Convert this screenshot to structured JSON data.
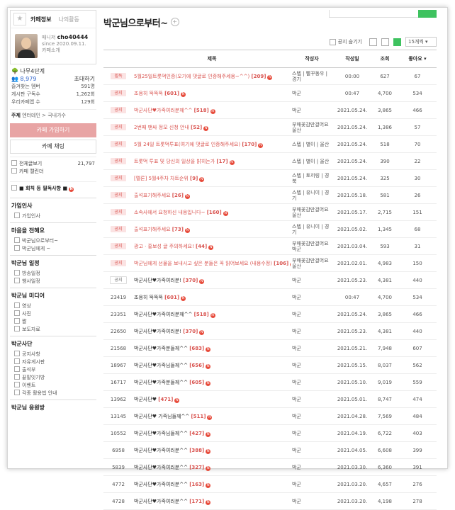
{
  "sidebar": {
    "tabs": [
      "카페정보",
      "나의활동"
    ],
    "profile": {
      "role": "매니저",
      "id": "cho40444",
      "since": "since 2020.09.11.",
      "intro": "카페소개"
    },
    "stats": {
      "level": "나무4단계",
      "members": "8,979",
      "invite": "초대하기",
      "fav_label": "즐겨찾는 멤버",
      "fav_value": "591명",
      "sub_label": "게시판 구독수",
      "sub_value": "1,262회",
      "rank_label": "우리카페앱 수",
      "rank_value": "129회"
    },
    "topic": {
      "label": "주제",
      "value": "엔터테인 > 국내가수"
    },
    "join_button": "카페 가입하기",
    "chat_button": "카페 채팅",
    "total": {
      "label": "전체글보기",
      "value": "21,797"
    },
    "calendar": "카페 캘린더",
    "pinned": "회칙 등 필독사항",
    "sections": [
      {
        "title": "가입인사",
        "items": [
          "가입인사"
        ]
      },
      {
        "title": "마음을 전해요",
        "items": [
          "박군님으로부터~",
          "박군님에게 ~"
        ]
      },
      {
        "title": "박군님 일정",
        "items": [
          "방송일정",
          "행사일정"
        ]
      },
      {
        "title": "박군님 미디어",
        "items": [
          "영상",
          "사진",
          "짤",
          "보도자료"
        ]
      },
      {
        "title": "박군사단",
        "items": [
          "공지사항",
          "자유게시판",
          "출석부",
          "끝말잇기방",
          "이벤트",
          "각종 활용법 안내"
        ]
      },
      {
        "title": "박군님 응원방",
        "items": []
      }
    ]
  },
  "main": {
    "title": "박군님으로부터~",
    "toolbar": {
      "hide_notice": "공지 숨기기",
      "per_page": "15개씩"
    },
    "columns": {
      "subject": "제목",
      "author": "작성자",
      "date": "작성일",
      "views": "조회",
      "likes": "좋아요 ▾"
    },
    "rows": [
      {
        "badge": "필독",
        "subject": "5월25일트롯먹인증(오기에 댓글로 인증해주세용~^^)",
        "count": "[209]",
        "author": "스텝 | 빨꾸동우 | 경기",
        "date": "00:00",
        "views": "627",
        "likes": "67"
      },
      {
        "badge": "공지",
        "subject": "조용히 뚝뚝뚝",
        "count": "[601]",
        "author": "박군",
        "date": "00:47",
        "views": "4,700",
        "likes": "534"
      },
      {
        "badge": "공지",
        "subject": "박군사단♥가족여러분께^^",
        "count": "[518]",
        "author": "박군",
        "date": "2021.05.24.",
        "views": "3,865",
        "likes": "466"
      },
      {
        "badge": "공지",
        "subject": "2번째 팬싸 정모 신청 안내",
        "count": "[52]",
        "author": "부매꽃감만걸어요 울산",
        "date": "2021.05.24.",
        "views": "1,386",
        "likes": "57"
      },
      {
        "badge": "공지",
        "subject": "5월 24일 트롯먹투표(여기에 댓글로 인증해주세요)",
        "count": "[170]",
        "author": "스텝 | 별이 | 울산",
        "date": "2021.05.24.",
        "views": "518",
        "likes": "70"
      },
      {
        "badge": "공지",
        "subject": "트롯먹 투표 및 당신의 일상을 밝히는가",
        "count": "[17]",
        "author": "스텝 | 별이 | 울산",
        "date": "2021.05.24.",
        "views": "390",
        "likes": "22"
      },
      {
        "badge": "공지",
        "subject": "[멜론] 5월4주차 차트순위",
        "count": "[9]",
        "author": "스텝 | 토끼링 | 경북",
        "date": "2021.05.24.",
        "views": "325",
        "likes": "30"
      },
      {
        "badge": "공지",
        "subject": "출석표기해주세요",
        "count": "[26]",
        "author": "스텝 | 유니이 | 경기",
        "date": "2021.05.18.",
        "views": "581",
        "likes": "26"
      },
      {
        "badge": "공지",
        "subject": "소속사에서 요청하신 내용입니다~",
        "count": "[160]",
        "author": "부매꽃감만걸어요 울산",
        "date": "2021.05.17.",
        "views": "2,715",
        "likes": "151"
      },
      {
        "badge": "공지",
        "subject": "출석표기해주세요",
        "count": "[73]",
        "author": "스텝 | 유니이 | 경기",
        "date": "2021.05.02.",
        "views": "1,345",
        "likes": "68"
      },
      {
        "badge": "공지",
        "subject": "광고 · 홍보성 글 주의하세요!",
        "count": "[44]",
        "author": "부매꽃감만걸어요 박군",
        "date": "2021.03.04.",
        "views": "593",
        "likes": "31"
      },
      {
        "badge": "공지",
        "subject": "박군님에게 선물을 보내시고 싶은 분들은 꼭 읽어보세요 (내용수정)",
        "count": "[106]",
        "author": "부매꽃감만걸어요 울산",
        "date": "2021.02.01.",
        "views": "4,983",
        "likes": "150"
      },
      {
        "badge": "공지w",
        "subject": "박군사단♥가족여러분!",
        "count": "[370]",
        "author": "박군",
        "date": "2021.05.23.",
        "views": "4,381",
        "likes": "440"
      },
      {
        "num": "23419",
        "subject": "조용히 뚝뚝뚝",
        "count": "[601]",
        "author": "박군",
        "date": "00:47",
        "views": "4,700",
        "likes": "534"
      },
      {
        "num": "23351",
        "subject": "박군사단♥가족여러분께^^",
        "count": "[518]",
        "author": "박군",
        "date": "2021.05.24.",
        "views": "3,865",
        "likes": "466"
      },
      {
        "num": "22650",
        "subject": "박군사단♥가족여러분!",
        "count": "[370]",
        "author": "박군",
        "date": "2021.05.23.",
        "views": "4,381",
        "likes": "440"
      },
      {
        "num": "21568",
        "subject": "박군사단♥가족분들께^^",
        "count": "[683]",
        "author": "박군",
        "date": "2021.05.21.",
        "views": "7,948",
        "likes": "607"
      },
      {
        "num": "18967",
        "subject": "박군사단♥가족님들께^^",
        "count": "[656]",
        "author": "박군",
        "date": "2021.05.15.",
        "views": "8,037",
        "likes": "562"
      },
      {
        "num": "16717",
        "subject": "박군사단♥가족분들께^^",
        "count": "[605]",
        "author": "박군",
        "date": "2021.05.10.",
        "views": "9,019",
        "likes": "559"
      },
      {
        "num": "13962",
        "subject": "박군사단♥",
        "count": "[471]",
        "author": "박군",
        "date": "2021.05.01.",
        "views": "8,747",
        "likes": "474"
      },
      {
        "num": "13145",
        "subject": "박군사단♥ 가족님들께^^",
        "count": "[511]",
        "author": "박군",
        "date": "2021.04.28.",
        "views": "7,569",
        "likes": "484"
      },
      {
        "num": "10552",
        "subject": "박군사단♥가족님들께^^",
        "count": "[427]",
        "author": "박군",
        "date": "2021.04.19.",
        "views": "6,722",
        "likes": "403"
      },
      {
        "num": "6958",
        "subject": "박군사단♥가족여러분^^",
        "count": "[388]",
        "author": "박군",
        "date": "2021.04.05.",
        "views": "6,608",
        "likes": "399"
      },
      {
        "num": "5839",
        "subject": "박군사단♥가족여러분^^",
        "count": "[327]",
        "author": "박군",
        "date": "2021.03.30.",
        "views": "6,360",
        "likes": "391"
      },
      {
        "num": "4772",
        "subject": "박군사단♥가족여러분^^",
        "count": "[163]",
        "author": "박군",
        "date": "2021.03.20.",
        "views": "4,657",
        "likes": "276"
      },
      {
        "num": "4728",
        "subject": "박군사단♥가족여러분^^",
        "count": "[171]",
        "author": "박군",
        "date": "2021.03.20.",
        "views": "4,198",
        "likes": "278"
      }
    ]
  }
}
